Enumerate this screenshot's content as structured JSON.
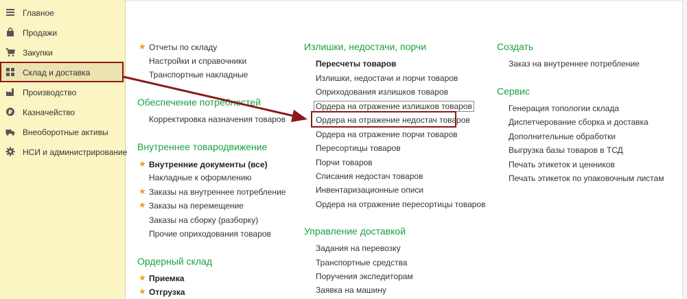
{
  "sidebar": {
    "items": [
      {
        "label": "Главное",
        "icon": "menu-lines-icon"
      },
      {
        "label": "Продажи",
        "icon": "shopping-bag-icon"
      },
      {
        "label": "Закупки",
        "icon": "shopping-cart-icon"
      },
      {
        "label": "Склад и доставка",
        "icon": "warehouse-grid-icon"
      },
      {
        "label": "Производство",
        "icon": "factory-icon"
      },
      {
        "label": "Казначейство",
        "icon": "coin-icon"
      },
      {
        "label": "Внеоборотные активы",
        "icon": "truck-icon"
      },
      {
        "label": "НСИ и администрирование",
        "icon": "gear-icon"
      }
    ]
  },
  "col1": {
    "top_links": [
      "Отчеты по складу",
      "Настройки и справочники",
      "Транспортные накладные"
    ],
    "provision": {
      "title": "Обеспечение потребностей",
      "links": [
        "Корректировка назначения товаров"
      ]
    },
    "internal": {
      "title": "Внутреннее товародвижение",
      "links": [
        "Внутренние документы (все)",
        "Накладные к оформлению",
        "Заказы на внутреннее потребление",
        "Заказы на перемещение",
        "Заказы на сборку (разборку)",
        "Прочие оприходования товаров"
      ]
    },
    "order_warehouse": {
      "title": "Ордерный склад",
      "links": [
        "Приемка",
        "Отгрузка"
      ]
    }
  },
  "col2": {
    "surplus": {
      "title": "Излишки, недостачи, порчи",
      "links": [
        "Пересчеты товаров",
        "Излишки, недостачи и порчи товаров",
        "Оприходования излишков товаров",
        "Ордера на отражение излишков товаров",
        "Ордера на отражение недостач товаров",
        "Ордера на отражение порчи товаров",
        "Пересортицы товаров",
        "Порчи товаров",
        "Списания недостач товаров",
        "Инвентаризационные описи",
        "Ордера на отражение пересортицы товаров"
      ]
    },
    "delivery": {
      "title": "Управление доставкой",
      "links": [
        "Задания на перевозку",
        "Транспортные средства",
        "Поручения экспедиторам",
        "Заявка на машину"
      ]
    }
  },
  "col3": {
    "create": {
      "title": "Создать",
      "links": [
        "Заказ на внутреннее потребление"
      ]
    },
    "service": {
      "title": "Сервис",
      "links": [
        "Генерация топологии склада",
        "Диспетчерование сборка и доставка",
        "Дополнительные обработки",
        "Выгрузка базы товаров в ТСД",
        "Печать этикеток и ценников",
        "Печать этикеток по упаковочным листам"
      ]
    }
  },
  "colors": {
    "sidebar_bg": "#fbf4c3",
    "group_title": "#19a041",
    "star": "#e7a21c",
    "highlight": "#8a1a1a"
  }
}
